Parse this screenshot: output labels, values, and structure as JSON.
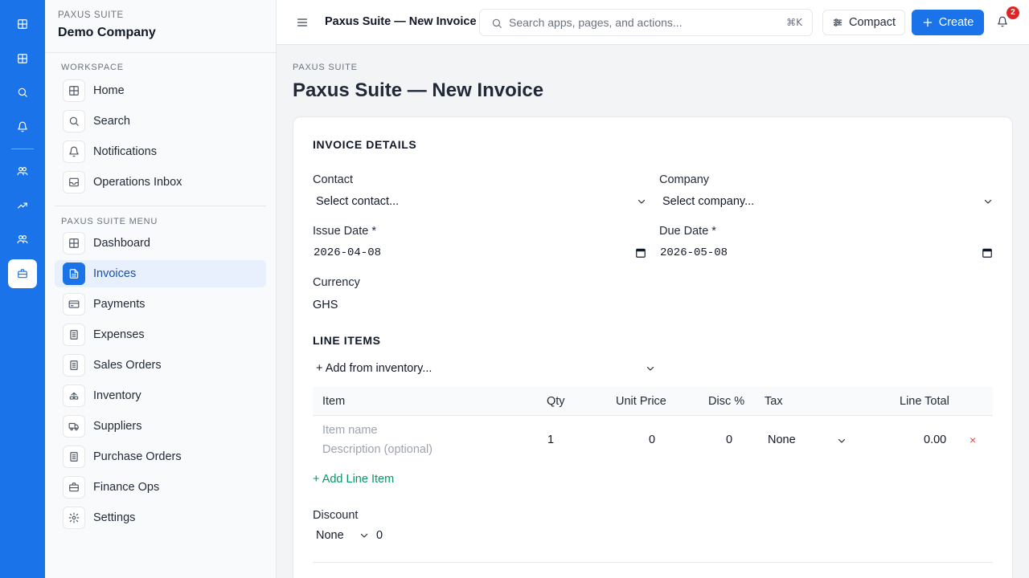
{
  "rail": {
    "items": [
      {
        "icon": "grid-icon",
        "active": false
      },
      {
        "icon": "grid-icon",
        "active": false
      },
      {
        "icon": "search-icon",
        "active": false
      },
      {
        "icon": "bell-icon",
        "active": false
      },
      {
        "icon": "users-icon",
        "active": false
      },
      {
        "icon": "trending-up-icon",
        "active": false
      },
      {
        "icon": "users-icon",
        "active": false
      },
      {
        "icon": "briefcase-icon",
        "active": true
      }
    ]
  },
  "sidebar": {
    "suite_label": "PAXUS SUITE",
    "company_name": "Demo Company",
    "workspace_label": "WORKSPACE",
    "workspace_items": [
      {
        "label": "Home",
        "icon": "grid-icon"
      },
      {
        "label": "Search",
        "icon": "search-icon"
      },
      {
        "label": "Notifications",
        "icon": "bell-icon"
      },
      {
        "label": "Operations Inbox",
        "icon": "inbox-icon"
      }
    ],
    "menu_label": "PAXUS SUITE MENU",
    "menu_items": [
      {
        "label": "Dashboard",
        "icon": "grid-icon",
        "active": false
      },
      {
        "label": "Invoices",
        "icon": "file-text-icon",
        "active": true
      },
      {
        "label": "Payments",
        "icon": "credit-card-icon",
        "active": false
      },
      {
        "label": "Expenses",
        "icon": "receipt-icon",
        "active": false
      },
      {
        "label": "Sales Orders",
        "icon": "receipt-icon",
        "active": false
      },
      {
        "label": "Inventory",
        "icon": "boxes-icon",
        "active": false
      },
      {
        "label": "Suppliers",
        "icon": "truck-icon",
        "active": false
      },
      {
        "label": "Purchase Orders",
        "icon": "receipt-icon",
        "active": false
      },
      {
        "label": "Finance Ops",
        "icon": "briefcase-icon",
        "active": false
      },
      {
        "label": "Settings",
        "icon": "gear-icon",
        "active": false
      }
    ]
  },
  "header": {
    "title": "Paxus Suite — New Invoice",
    "search_placeholder": "Search apps, pages, and actions...",
    "shortcut": "⌘K",
    "compact_label": "Compact",
    "create_label": "Create",
    "notification_count": "2"
  },
  "page": {
    "breadcrumb": "PAXUS SUITE",
    "title": "Paxus Suite — New Invoice"
  },
  "invoice": {
    "details_heading": "INVOICE DETAILS",
    "contact_label": "Contact",
    "contact_value": "Select contact...",
    "company_label": "Company",
    "company_value": "Select company...",
    "issue_date_label": "Issue Date *",
    "issue_date_value": "2026-04-08",
    "due_date_label": "Due Date *",
    "due_date_value": "2026-05-08",
    "currency_label": "Currency",
    "currency_value": "GHS",
    "line_items_heading": "LINE ITEMS",
    "add_from_inventory": "+ Add from inventory...",
    "columns": [
      "Item",
      "Qty",
      "Unit Price",
      "Disc %",
      "Tax",
      "Line Total"
    ],
    "rows": [
      {
        "item_placeholder": "Item name",
        "description_placeholder": "Description (optional)",
        "qty": "1",
        "unit_price": "0",
        "disc": "0",
        "tax": "None",
        "line_total": "0.00",
        "remove": "×"
      }
    ],
    "add_line_item": "+ Add Line Item",
    "discount_label": "Discount",
    "discount_type": "None",
    "discount_value": "0"
  },
  "colors": {
    "accent": "#1a73e8",
    "success_link": "#059669",
    "danger": "#ef4444",
    "badge": "#dc2626"
  }
}
